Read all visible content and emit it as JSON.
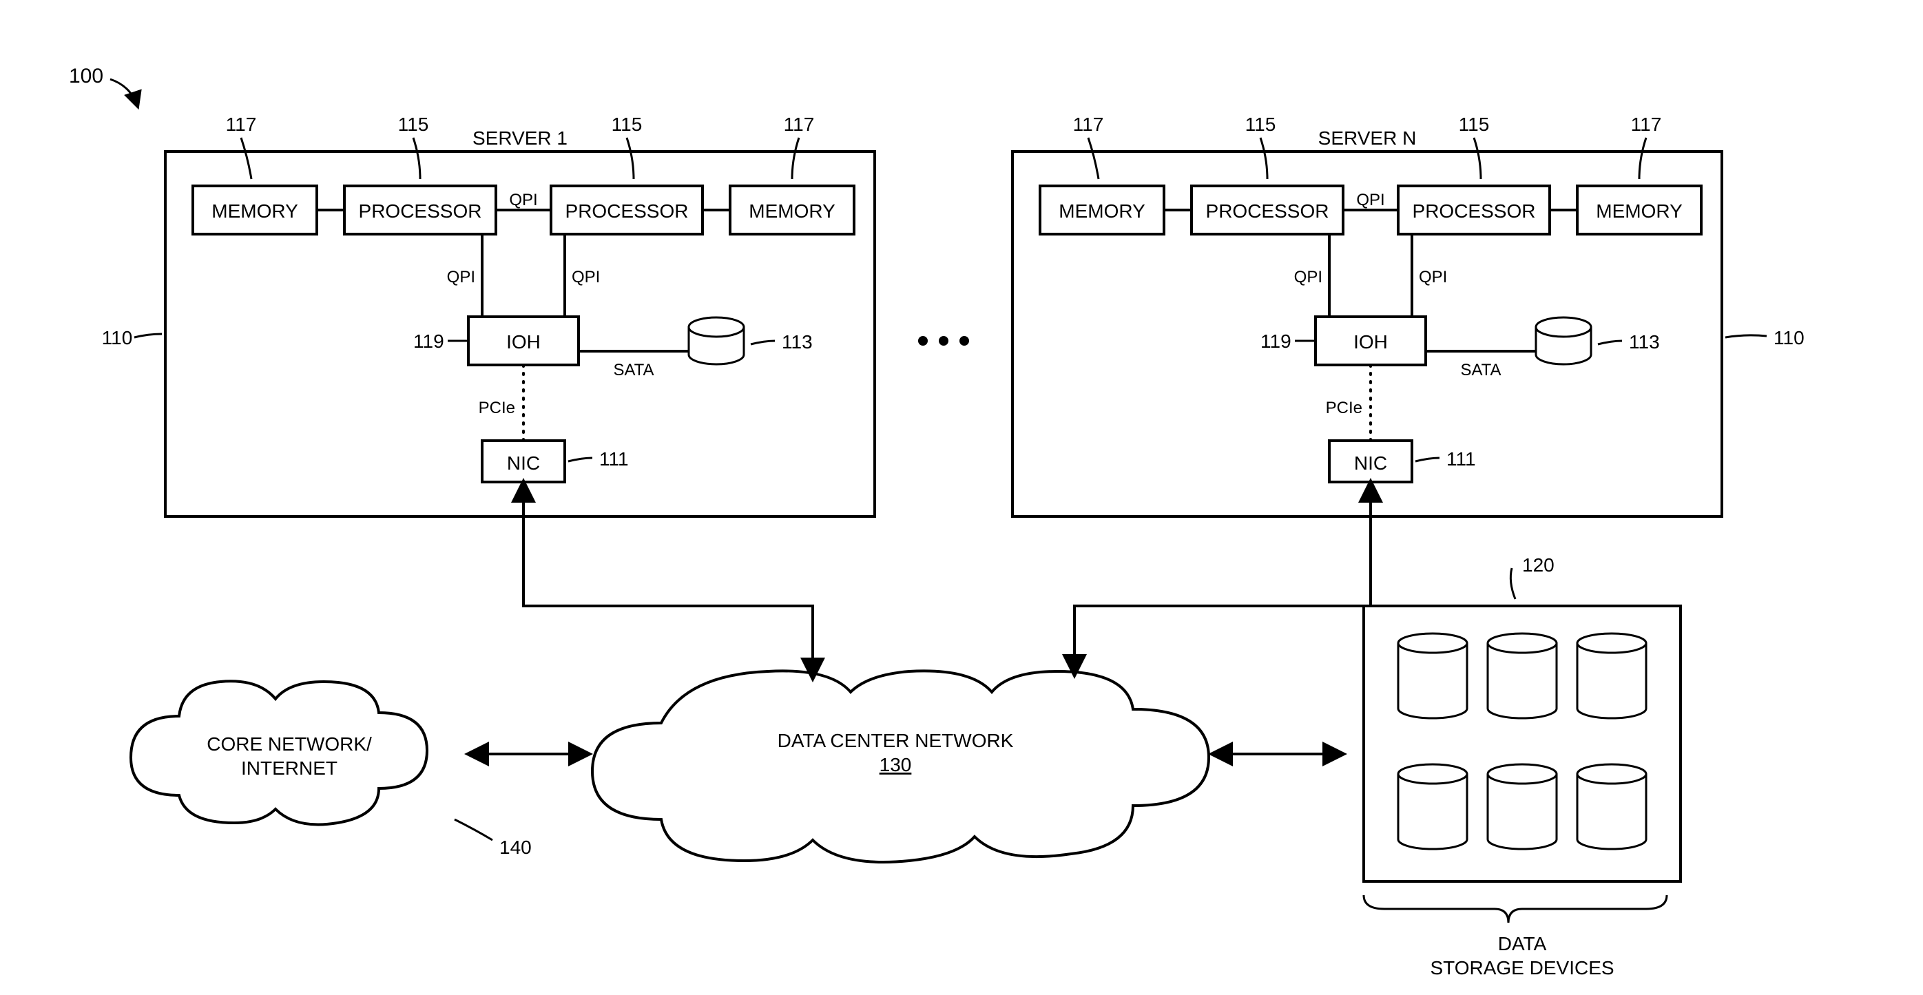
{
  "figure_ref": "100",
  "servers": [
    {
      "title": "SERVER 1",
      "ref_box": "110",
      "memory_label": "MEMORY",
      "processor_label": "PROCESSOR",
      "ioh_label": "IOH",
      "nic_label": "NIC",
      "qpi_label": "QPI",
      "sata_label": "SATA",
      "pcie_label": "PCIe",
      "ref_memory": "117",
      "ref_processor": "115",
      "ref_ioh": "119",
      "ref_disk": "113",
      "ref_nic": "111"
    },
    {
      "title": "SERVER N",
      "ref_box": "110",
      "memory_label": "MEMORY",
      "processor_label": "PROCESSOR",
      "ioh_label": "IOH",
      "nic_label": "NIC",
      "qpi_label": "QPI",
      "sata_label": "SATA",
      "pcie_label": "PCIe",
      "ref_memory": "117",
      "ref_processor": "115",
      "ref_ioh": "119",
      "ref_disk": "113",
      "ref_nic": "111"
    }
  ],
  "ellipsis": "•••",
  "clouds": {
    "core": {
      "line1": "CORE NETWORK/",
      "line2": "INTERNET",
      "ref": "140"
    },
    "dcn": {
      "line1": "DATA CENTER NETWORK",
      "ref": "130"
    }
  },
  "storage": {
    "ref": "120",
    "caption_line1": "DATA",
    "caption_line2": "STORAGE DEVICES"
  }
}
